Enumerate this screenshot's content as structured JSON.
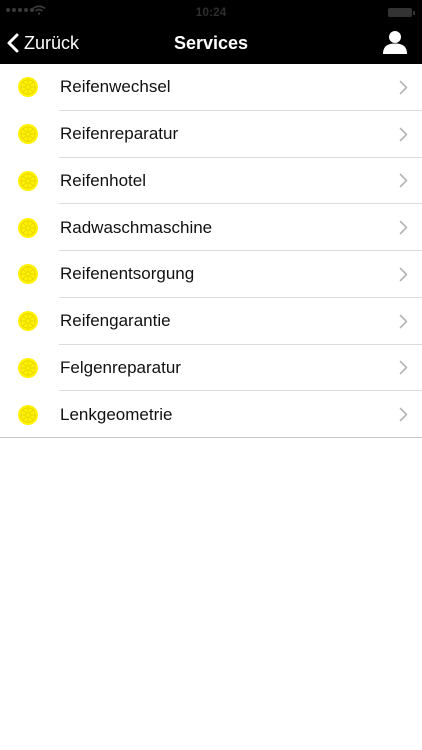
{
  "status_bar": {
    "time": "10:24"
  },
  "nav": {
    "back_label": "Zurück",
    "title": "Services",
    "profile_icon": "person-icon"
  },
  "colors": {
    "bar_background": "#000000",
    "icon_yellow": "#fff200",
    "chevron": "#b5b5b5"
  },
  "services": [
    {
      "label": "Reifenwechsel",
      "icon": "wheel-icon"
    },
    {
      "label": "Reifenreparatur",
      "icon": "wheel-icon"
    },
    {
      "label": "Reifenhotel",
      "icon": "wheel-icon"
    },
    {
      "label": "Radwaschmaschine",
      "icon": "wheel-icon"
    },
    {
      "label": "Reifenentsorgung",
      "icon": "wheel-icon"
    },
    {
      "label": "Reifengarantie",
      "icon": "wheel-icon"
    },
    {
      "label": "Felgenreparatur",
      "icon": "wheel-icon"
    },
    {
      "label": "Lenkgeometrie",
      "icon": "wheel-icon"
    }
  ]
}
